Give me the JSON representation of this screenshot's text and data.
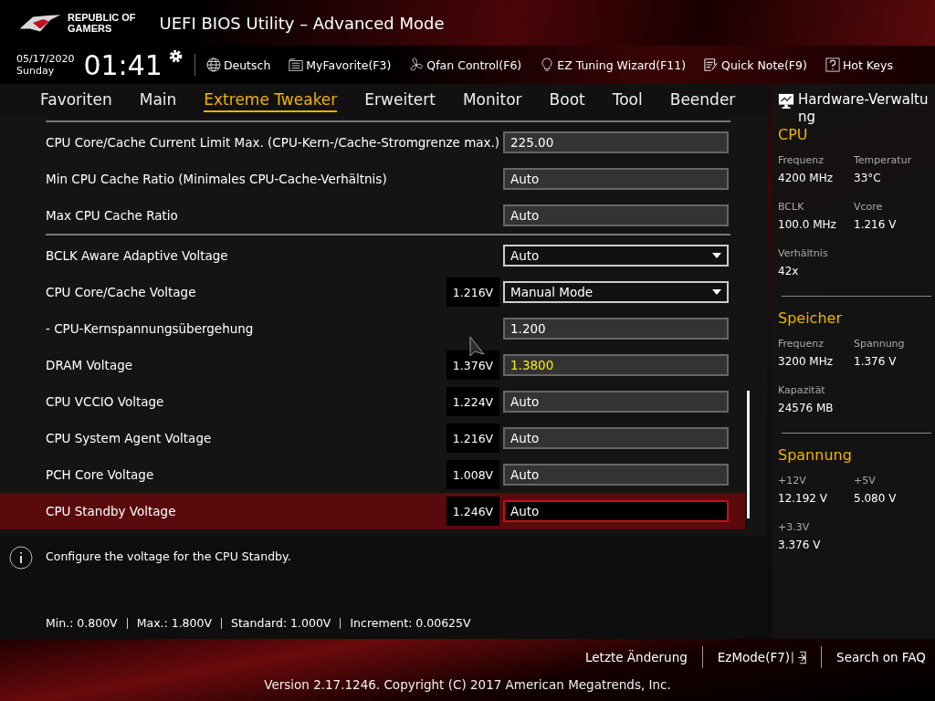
{
  "header": {
    "brand": [
      "REPUBLIC OF",
      "GAMERS"
    ],
    "title": "UEFI BIOS Utility – Advanced Mode"
  },
  "toolbar": {
    "date": "05/17/2020",
    "day": "Sunday",
    "time": "01:41",
    "items": [
      {
        "kind": "globe",
        "label": "Deutsch"
      },
      {
        "kind": "favorite",
        "label": "MyFavorite(F3)"
      },
      {
        "kind": "fan",
        "label": "Qfan Control(F6)"
      },
      {
        "kind": "bulb",
        "label": "EZ Tuning Wizard(F11)"
      },
      {
        "kind": "note",
        "label": "Quick Note(F9)"
      },
      {
        "kind": "help",
        "label": "Hot Keys"
      }
    ]
  },
  "tabs": [
    {
      "label": "Favoriten",
      "selected": false
    },
    {
      "label": "Main",
      "selected": false
    },
    {
      "label": "Extreme Tweaker",
      "selected": true
    },
    {
      "label": "Erweitert",
      "selected": false
    },
    {
      "label": "Monitor",
      "selected": false
    },
    {
      "label": "Boot",
      "selected": false
    },
    {
      "label": "Tool",
      "selected": false
    },
    {
      "label": "Beender",
      "selected": false
    }
  ],
  "settings": [
    {
      "kind": "separator"
    },
    {
      "kind": "field",
      "label": "CPU Core/Cache Current Limit Max. (CPU-Kern-/Cache-Stromgrenze max.)",
      "value": "225.00",
      "modified": false,
      "selected": false
    },
    {
      "kind": "field",
      "label": "Min CPU Cache Ratio (Minimales CPU-Cache-Verhältnis)",
      "value": "Auto",
      "modified": false,
      "selected": false
    },
    {
      "kind": "field",
      "label": "Max CPU Cache Ratio",
      "value": "Auto",
      "modified": false,
      "selected": false
    },
    {
      "kind": "separator"
    },
    {
      "kind": "dropdown",
      "label": "BCLK Aware Adaptive Voltage",
      "value": "Auto",
      "modified": false,
      "selected": false
    },
    {
      "kind": "dropdown",
      "label": "CPU Core/Cache Voltage",
      "reading": "1.216V",
      "value": "Manual Mode",
      "modified": false,
      "selected": false
    },
    {
      "kind": "field",
      "label": " - CPU-Kernspannungsübergehung",
      "value": "1.200",
      "modified": false,
      "selected": false
    },
    {
      "kind": "field",
      "label": "DRAM Voltage",
      "reading": "1.376V",
      "value": "1.3800",
      "modified": true,
      "selected": false
    },
    {
      "kind": "field",
      "label": "CPU VCCIO Voltage",
      "reading": "1.224V",
      "value": "Auto",
      "modified": false,
      "selected": false
    },
    {
      "kind": "field",
      "label": "CPU System Agent Voltage",
      "reading": "1.216V",
      "value": "Auto",
      "modified": false,
      "selected": false
    },
    {
      "kind": "field",
      "label": "PCH Core Voltage",
      "reading": "1.008V",
      "value": "Auto",
      "modified": false,
      "selected": false
    },
    {
      "kind": "field",
      "label": "CPU Standby Voltage",
      "reading": "1.246V",
      "value": "Auto",
      "modified": false,
      "selected": true
    }
  ],
  "help": {
    "text": "Configure the voltage for the CPU Standby.",
    "limits": [
      "Min.: 0.800V",
      "Max.: 1.800V",
      "Standard: 1.000V",
      "Increment: 0.00625V"
    ]
  },
  "hardware_monitor": {
    "title": "Hardware-Verwaltung",
    "sections": [
      {
        "title": "CPU",
        "items": [
          {
            "label": "Frequenz",
            "value": "4200 MHz"
          },
          {
            "label": "Temperatur",
            "value": "33°C"
          },
          {
            "label": "BCLK",
            "value": "100.0 MHz"
          },
          {
            "label": "Vcore",
            "value": "1.216 V"
          },
          {
            "label": "Verhältnis",
            "value": "42x"
          }
        ]
      },
      {
        "title": "Speicher",
        "items": [
          {
            "label": "Frequenz",
            "value": "3200 MHz"
          },
          {
            "label": "Spannung",
            "value": "1.376 V"
          },
          {
            "label": "Kapazität",
            "value": "24576 MB"
          }
        ]
      },
      {
        "title": "Spannung",
        "items": [
          {
            "label": "+12V",
            "value": "12.192 V"
          },
          {
            "label": "+5V",
            "value": "5.080 V"
          },
          {
            "label": "+3.3V",
            "value": "3.376 V"
          }
        ]
      }
    ]
  },
  "footer": {
    "links": [
      {
        "kind": "text",
        "label": "Letzte Änderung"
      },
      {
        "kind": "exit",
        "label": "EzMode(F7)"
      },
      {
        "kind": "text",
        "label": "Search on FAQ"
      }
    ],
    "version": "Version 2.17.1246. Copyright (C) 2017 American Megatrends, Inc."
  }
}
